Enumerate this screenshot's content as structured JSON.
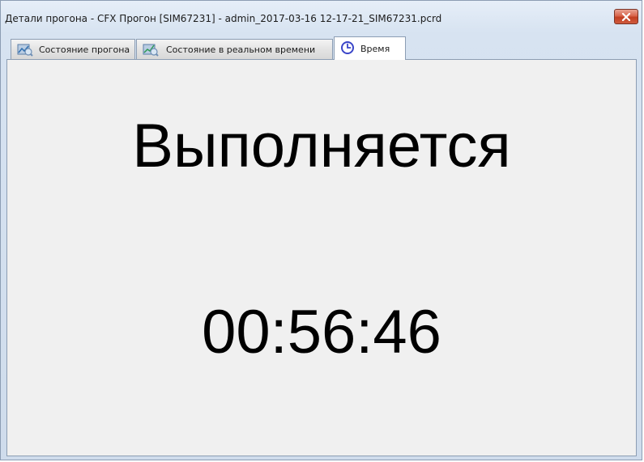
{
  "window": {
    "title": "Детали прогона - CFX Прогон [SIM67231] - admin_2017-03-16 12-17-21_SIM67231.pcrd",
    "close_icon": "close-icon"
  },
  "tabs": [
    {
      "label": "Состояние прогона",
      "icon": "run-status-icon",
      "active": false
    },
    {
      "label": "Состояние в реальном времени",
      "icon": "realtime-status-icon",
      "active": false
    },
    {
      "label": "Время",
      "icon": "clock-icon",
      "active": true
    }
  ],
  "main": {
    "status": "Выполняется",
    "elapsed_time": "00:56:46"
  },
  "colors": {
    "close_button": "#c9452b",
    "clock_icon": "#3a45c8",
    "content_background": "#f0f0f0"
  }
}
